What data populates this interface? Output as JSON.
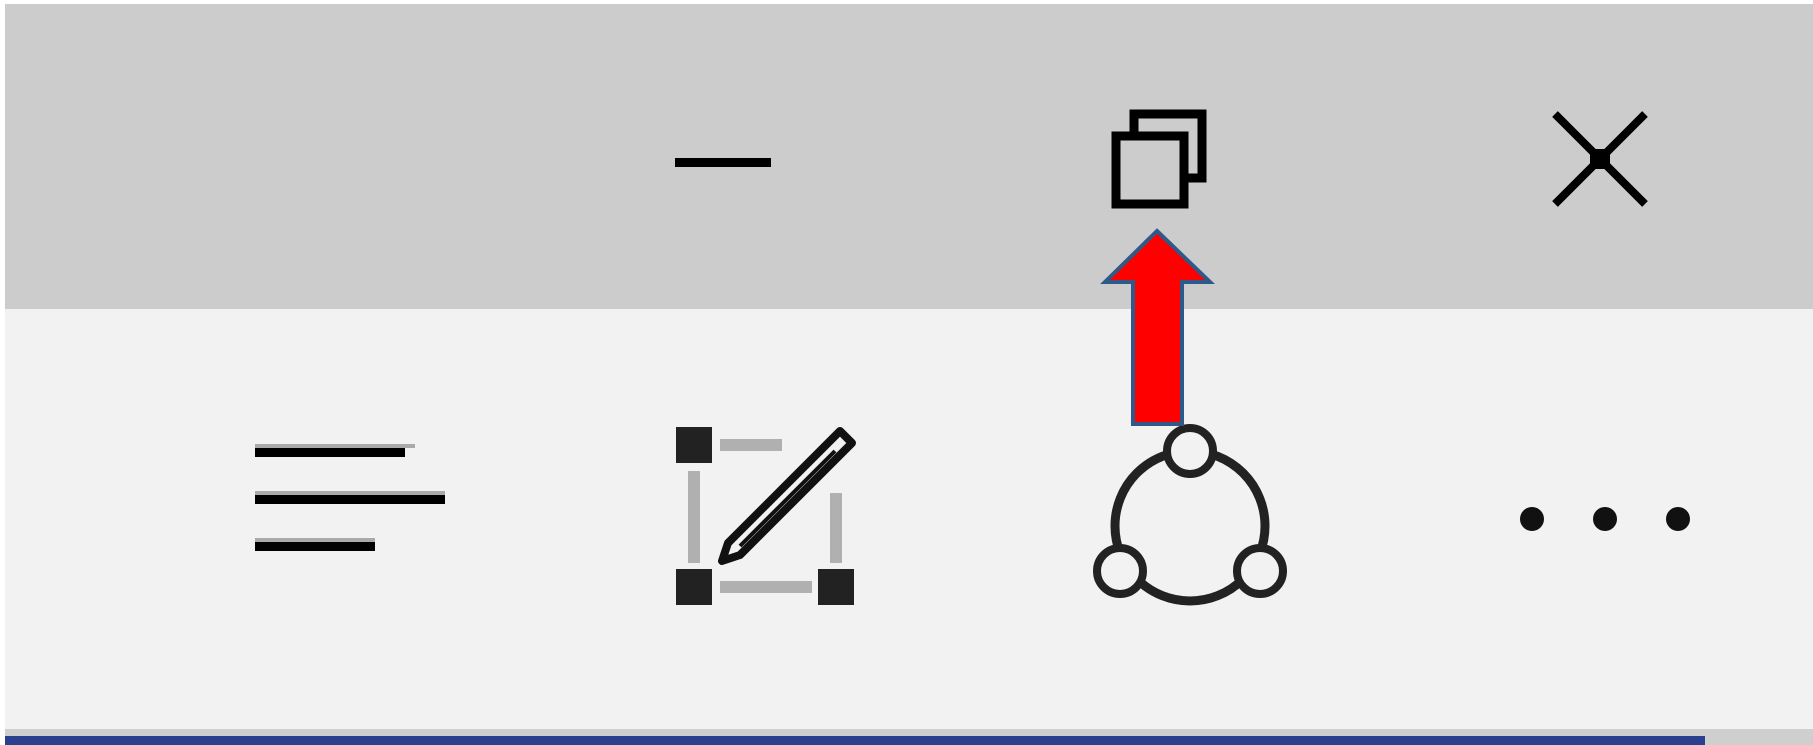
{
  "window_controls": {
    "minimize_icon": "minimize-icon",
    "restore_icon": "restore-icon",
    "close_icon": "close-icon"
  },
  "toolbar": {
    "items": [
      {
        "icon": "text-align-left-icon"
      },
      {
        "icon": "edit-shape-icon"
      },
      {
        "icon": "share-icon"
      },
      {
        "icon": "more-options-icon"
      }
    ]
  },
  "annotation": {
    "icon": "arrow-up-icon",
    "color": "#ff0000",
    "outline_color": "#2e5a8a"
  },
  "progress": {
    "fraction": 0.94,
    "color": "#2b3f8f"
  }
}
